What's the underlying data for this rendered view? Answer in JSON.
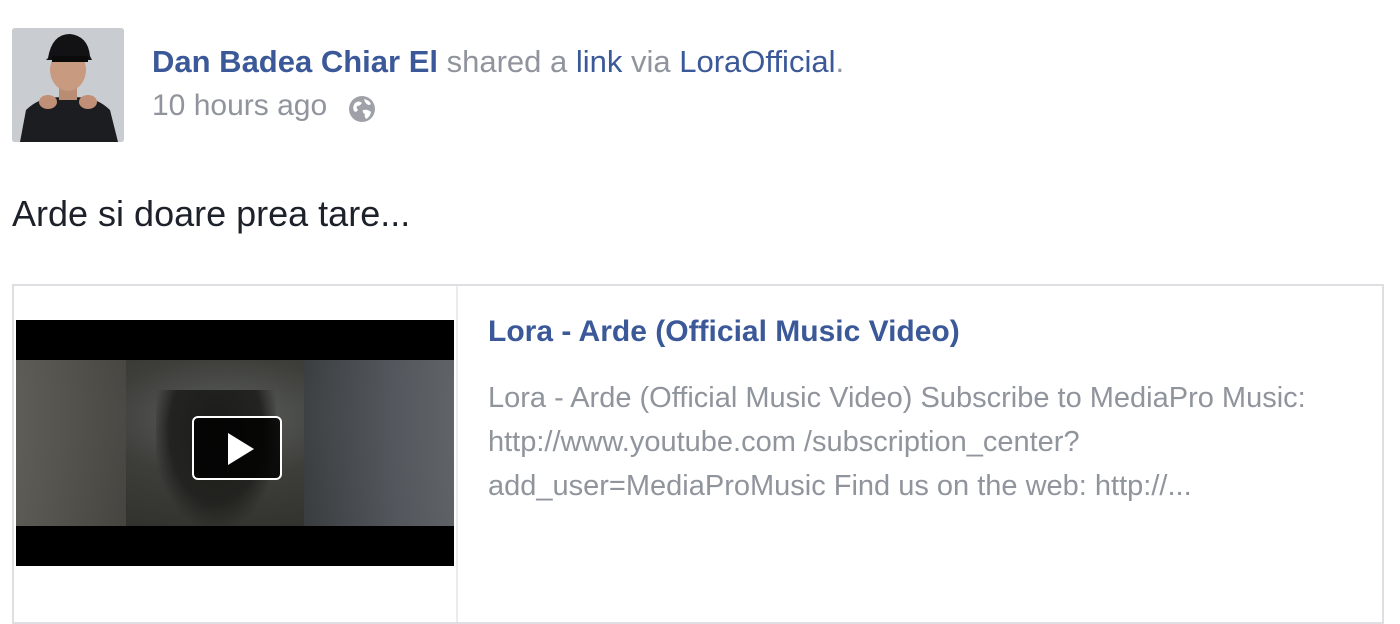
{
  "post": {
    "actor_name": "Dan Badea Chiar El",
    "shared_text": " shared a ",
    "link_word": "link",
    "via_text": " via ",
    "via_page": "LoraOfficial",
    "period": ".",
    "timestamp": "10 hours ago",
    "privacy_icon": "globe-icon",
    "message": "Arde si doare prea tare..."
  },
  "attachment": {
    "play_icon": "play-icon",
    "title": "Lora - Arde (Official Music Video)",
    "description": "Lora - Arde (Official Music Video) Subscribe to MediaPro Music: http://www.youtube.com /subscription_center?add_user=MediaProMusic Find us on the web: http://..."
  },
  "colors": {
    "link_blue": "#3b5998",
    "meta_gray": "#90949c",
    "text_dark": "#1d2129",
    "border": "#dddfe2"
  }
}
